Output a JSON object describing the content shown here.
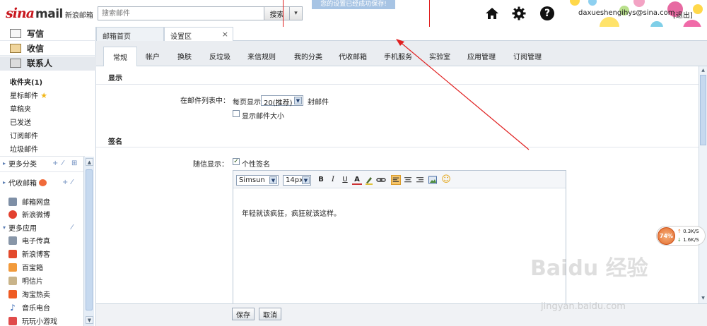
{
  "header": {
    "logo": {
      "part1": "sina",
      "part2": "mail",
      "part3": "新浪邮箱"
    },
    "search_placeholder": "搜索邮件",
    "search_button": "搜索",
    "search_dropdown": "▾",
    "toast": "您的设置已经成功保存!",
    "user_email": "daxueshengihys@sina.com",
    "logout": "[退出]",
    "icons": [
      "home-icon",
      "gear-icon",
      "help-icon"
    ],
    "help_glyph": "?"
  },
  "sidebar": {
    "compose": "写信",
    "inbox": "收信",
    "contacts": "联系人",
    "folders": [
      "收件夹(1)",
      "星标邮件",
      "草稿夹",
      "已发送",
      "订阅邮件",
      "垃圾邮件"
    ],
    "more_categories": "更多分类",
    "proxy_mail": "代收邮箱",
    "proxy_apps": [
      "邮箱网盘",
      "新浪微博"
    ],
    "more_apps": "更多应用",
    "apps": [
      "电子传真",
      "新浪博客",
      "百宝箱",
      "明信片",
      "淘宝热卖",
      "音乐电台",
      "玩玩小游戏"
    ],
    "actions": {
      "add": "+",
      "edit": "⁄",
      "manage": "⊞"
    }
  },
  "top_tabs": [
    {
      "label": "邮箱首页"
    },
    {
      "label": "设置区",
      "close": "×"
    }
  ],
  "settings_tabs": [
    "常规",
    "帐户",
    "换肤",
    "反垃圾",
    "来信规则",
    "我的分类",
    "代收邮箱",
    "手机服务",
    "实验室",
    "应用管理",
    "订阅管理"
  ],
  "display_section": {
    "title": "显示",
    "in_mail_list": "在邮件列表中：",
    "per_page": "每页显示",
    "per_page_value": "20(推荐)",
    "unit": "封邮件",
    "show_size": "显示邮件大小",
    "show_size_checked": false
  },
  "signature_section": {
    "title": "签名",
    "with_letter": "随信显示：",
    "personal_sign": "个性签名",
    "personal_sign_checked": true,
    "font_family": "Simsun",
    "font_size": "14px",
    "toolbar": {
      "bold": "B",
      "italic": "I",
      "underline": "U",
      "font_color": "A",
      "emoji": "☺"
    },
    "text": "年轻就该疯狂，疯狂就该这样。"
  },
  "footer": {
    "save": "保存",
    "cancel": "取消"
  },
  "speed_widget": {
    "percent": "74%",
    "up": "0.3K/S",
    "down": "1.6K/S"
  },
  "watermark": {
    "text": "Baidu 经验",
    "sub": "jingyan.baidu.com"
  },
  "colors": {
    "brand_red": "#c8161d",
    "annotation_red": "#e02020",
    "toast_bg": "#a7c4e4",
    "accent_blue": "#5a7cb2"
  }
}
